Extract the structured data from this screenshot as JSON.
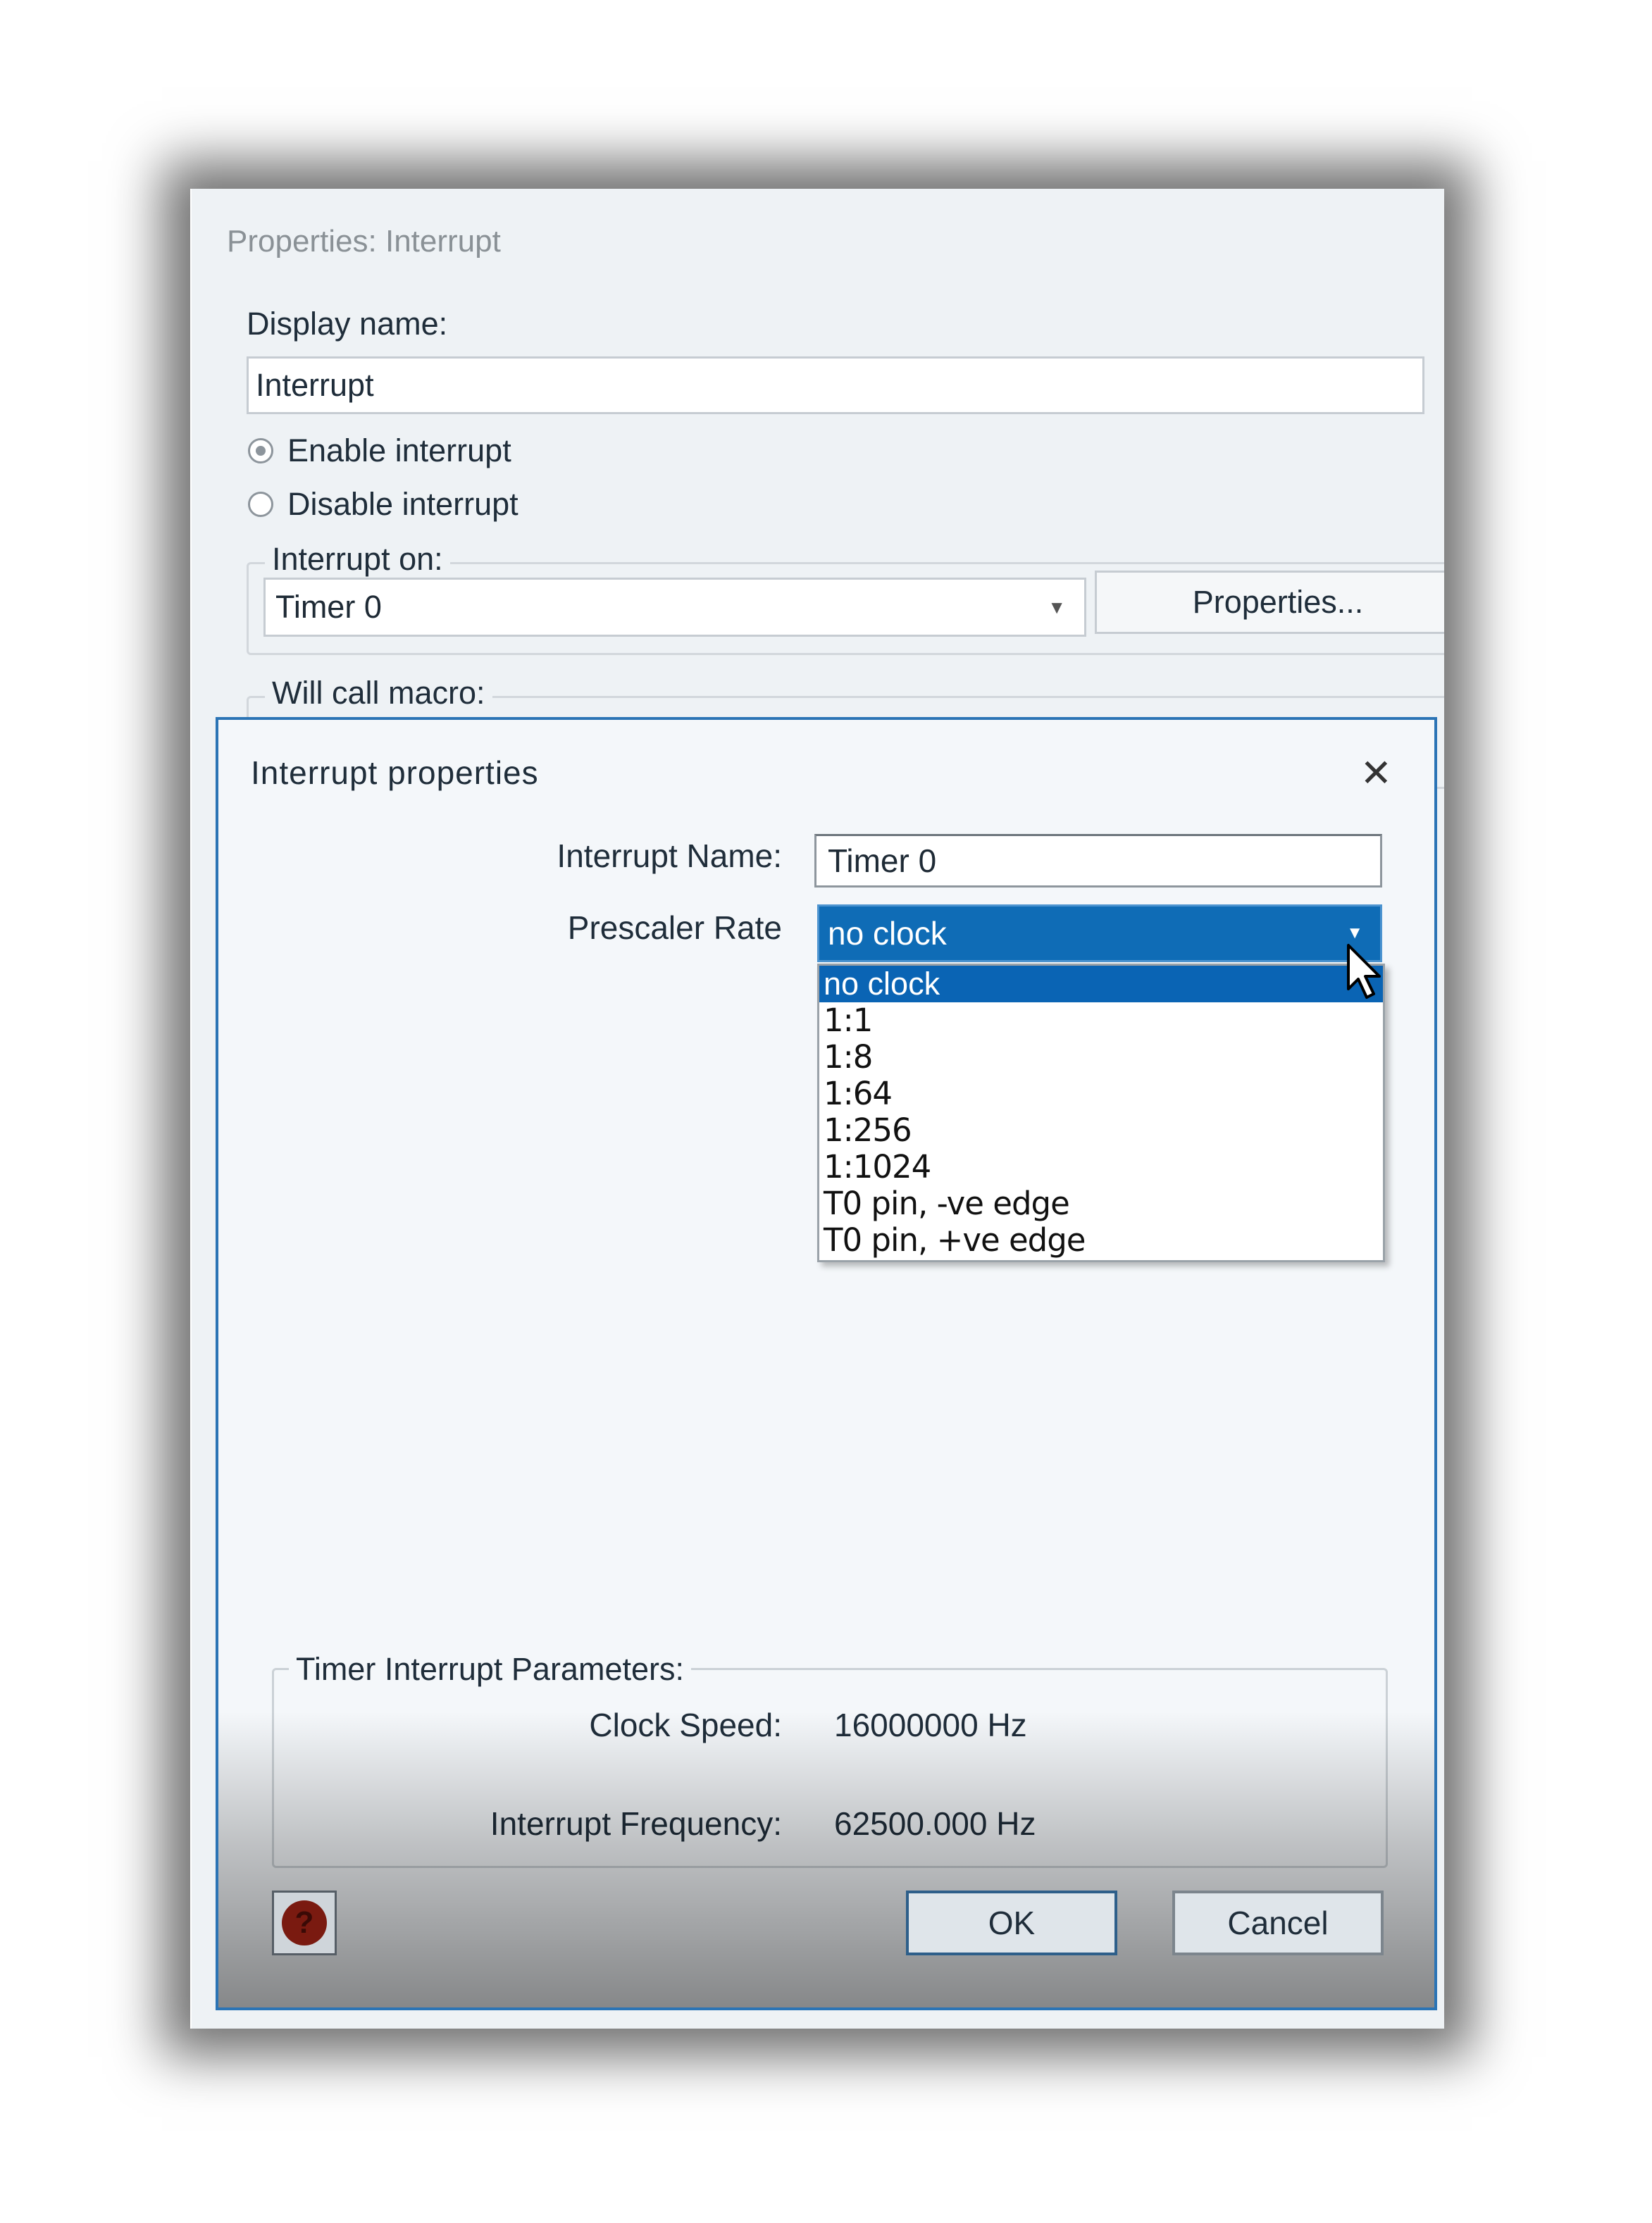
{
  "back_window": {
    "title": "Properties: Interrupt",
    "display_name_label": "Display name:",
    "display_name_value": "Interrupt",
    "radio_enable_label": "Enable interrupt",
    "radio_disable_label": "Disable interrupt",
    "radio_enable_checked": true,
    "interrupt_on_legend": "Interrupt on:",
    "interrupt_on_value": "Timer 0",
    "properties_button": "Properties...",
    "will_call_macro_legend": "Will call macro:"
  },
  "dialog": {
    "title": "Interrupt properties",
    "close_glyph": "✕",
    "interrupt_name_label": "Interrupt Name:",
    "interrupt_name_value": "Timer 0",
    "prescaler_label": "Prescaler Rate",
    "prescaler_value": "no clock",
    "prescaler_options": [
      "no clock",
      "1:1",
      "1:8",
      "1:64",
      "1:256",
      "1:1024",
      "T0 pin, -ve edge",
      "T0 pin, +ve edge"
    ],
    "prescaler_selected_index": 0,
    "timer_params_legend": "Timer Interrupt Parameters:",
    "clock_speed_label": "Clock Speed:",
    "clock_speed_value": "16000000 Hz",
    "interrupt_frequency_label": "Interrupt Frequency:",
    "interrupt_frequency_value": "62500.000 Hz",
    "ok_button": "OK",
    "cancel_button": "Cancel",
    "help_glyph": "?"
  },
  "icons": {
    "dropdown_arrow": "▼",
    "help_icon": "help-icon",
    "cursor_icon": "mouse-pointer-icon"
  },
  "colors": {
    "dialog_border": "#2b74b5",
    "selection_blue": "#0a64b4",
    "window_bg": "#eef2f5"
  }
}
